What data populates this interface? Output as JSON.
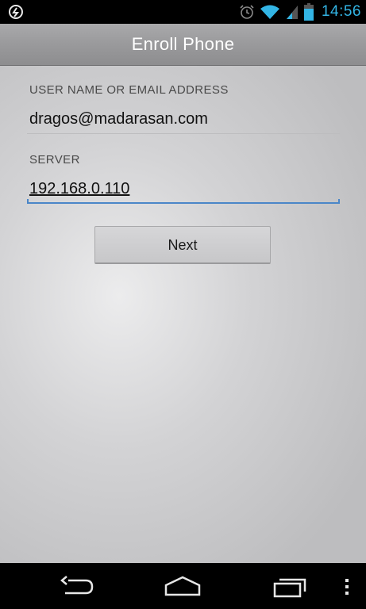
{
  "status_bar": {
    "time": "14:56",
    "icons": [
      "sync-icon",
      "alarm-icon",
      "wifi-icon",
      "signal-icon",
      "battery-icon"
    ]
  },
  "title_bar": {
    "title": "Enroll Phone"
  },
  "form": {
    "username_label": "USER NAME OR EMAIL ADDRESS",
    "username_value": "dragos@madarasan.com",
    "server_label": "SERVER",
    "server_value": "192.168.0.110",
    "next_label": "Next"
  },
  "nav_bar": {
    "buttons": [
      "back-icon",
      "home-icon",
      "recent-apps-icon",
      "menu-icon"
    ]
  },
  "colors": {
    "accent": "#33b5e5",
    "focus_underline": "#4a86c8"
  }
}
